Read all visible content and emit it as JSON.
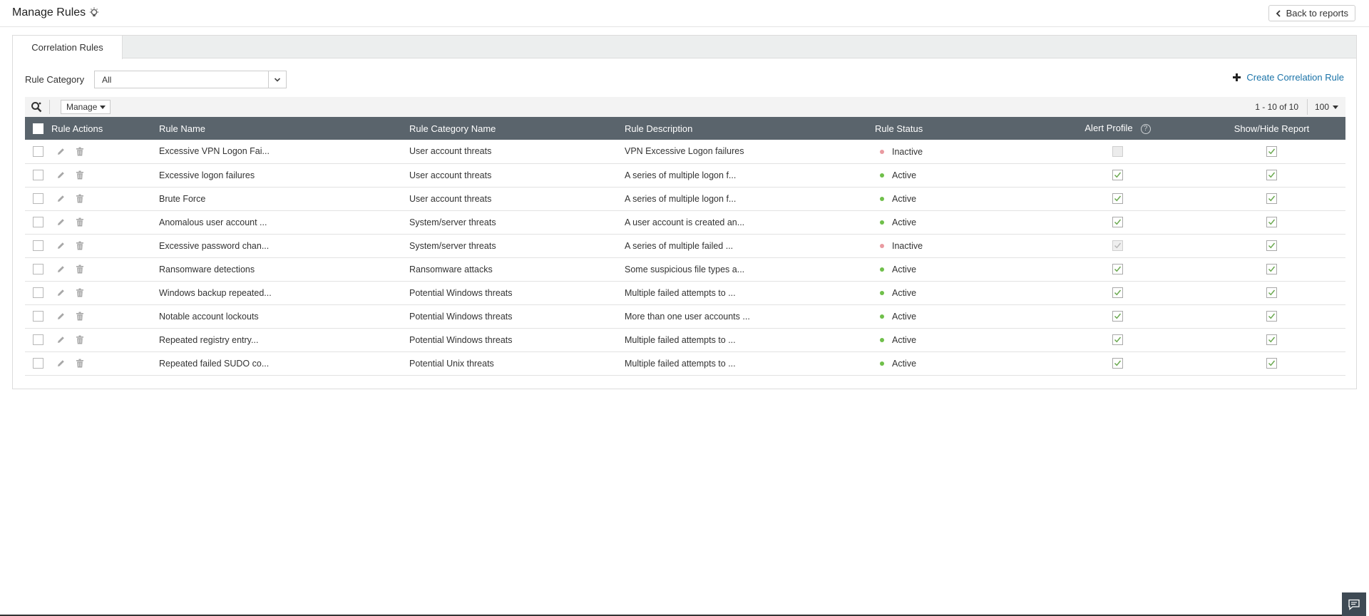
{
  "header": {
    "title": "Manage Rules",
    "back_label": "Back to reports"
  },
  "tabs": [
    {
      "label": "Correlation Rules",
      "active": true
    }
  ],
  "filter": {
    "label": "Rule Category",
    "selected": "All"
  },
  "create_label": "Create Correlation Rule",
  "toolbar": {
    "manage_label": "Manage",
    "pager": "1 - 10 of 10",
    "per_page": "100"
  },
  "columns": {
    "actions": "Rule Actions",
    "name": "Rule Name",
    "category": "Rule Category Name",
    "description": "Rule Description",
    "status": "Rule Status",
    "alert": "Alert Profile",
    "report": "Show/Hide Report"
  },
  "colors": {
    "active": "#6fbf4a",
    "inactive": "#e99aa0",
    "header_bg": "#5a646c",
    "link": "#1a73a8"
  },
  "rows": [
    {
      "name": "Excessive VPN Logon Fai...",
      "category": "User account threats",
      "description": "VPN Excessive Logon failures",
      "status": "Inactive",
      "alert": "off",
      "report": "on"
    },
    {
      "name": "Excessive logon failures",
      "category": "User account threats",
      "description": "A series of multiple logon f...",
      "status": "Active",
      "alert": "on",
      "report": "on"
    },
    {
      "name": "Brute Force",
      "category": "User account threats",
      "description": "A series of multiple logon f...",
      "status": "Active",
      "alert": "on",
      "report": "on"
    },
    {
      "name": "Anomalous user account ...",
      "category": "System/server threats",
      "description": "A user account is created an...",
      "status": "Active",
      "alert": "on",
      "report": "on"
    },
    {
      "name": "Excessive password chan...",
      "category": "System/server threats",
      "description": "A series of multiple failed ...",
      "status": "Inactive",
      "alert": "disabled",
      "report": "on"
    },
    {
      "name": "Ransomware detections",
      "category": "Ransomware attacks",
      "description": "Some suspicious file types a...",
      "status": "Active",
      "alert": "on",
      "report": "on"
    },
    {
      "name": "Windows backup repeated...",
      "category": "Potential Windows threats",
      "description": "Multiple failed attempts to ...",
      "status": "Active",
      "alert": "on",
      "report": "on"
    },
    {
      "name": "Notable account lockouts",
      "category": "Potential Windows threats",
      "description": "More than one user accounts ...",
      "status": "Active",
      "alert": "on",
      "report": "on"
    },
    {
      "name": "Repeated registry entry...",
      "category": "Potential Windows threats",
      "description": "Multiple failed attempts to ...",
      "status": "Active",
      "alert": "on",
      "report": "on"
    },
    {
      "name": "Repeated failed SUDO co...",
      "category": "Potential Unix threats",
      "description": "Multiple failed attempts to ...",
      "status": "Active",
      "alert": "on",
      "report": "on"
    }
  ]
}
